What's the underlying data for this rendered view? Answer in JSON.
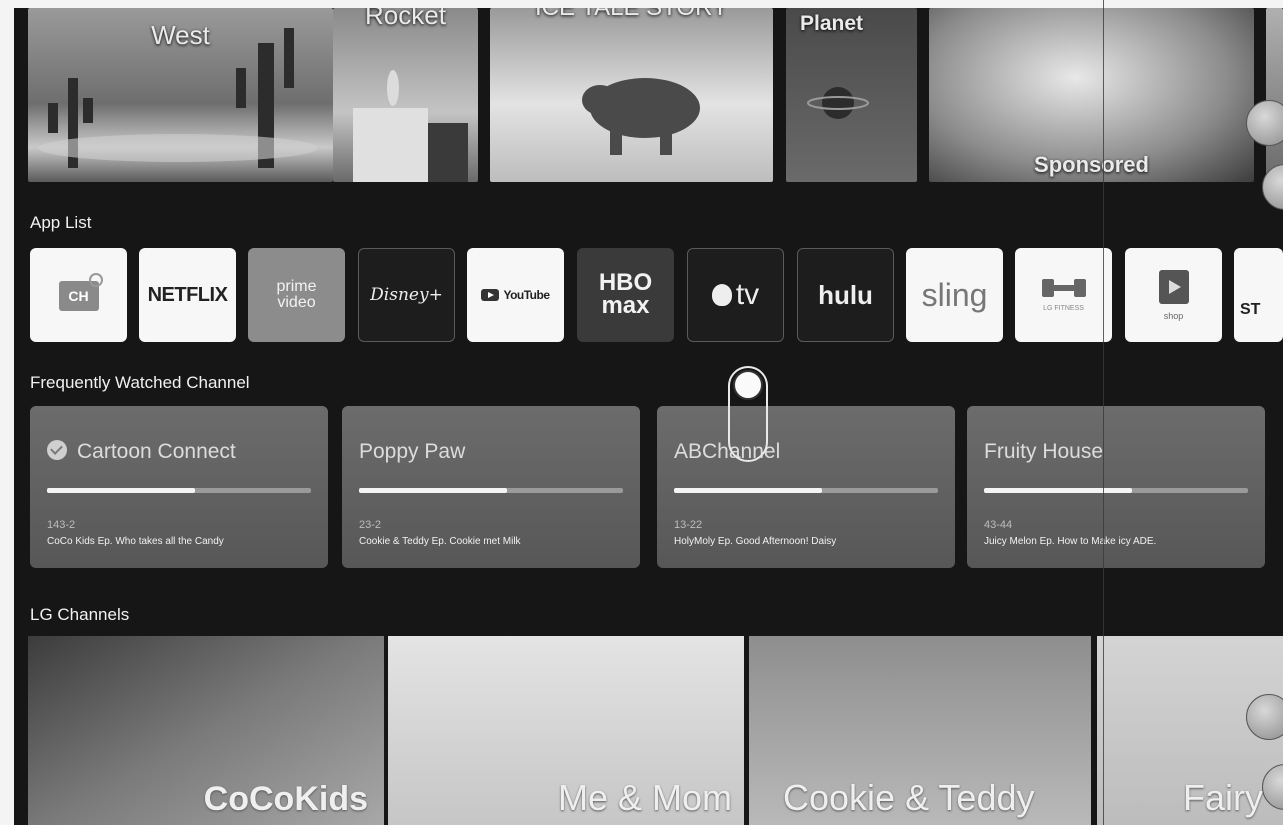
{
  "featured": [
    {
      "title": "West"
    },
    {
      "title": "Rocket"
    },
    {
      "title": "ICE TALE STORY"
    },
    {
      "title": "Planet"
    },
    {
      "title": "Sponsored"
    },
    {
      "title": ""
    }
  ],
  "app_list": {
    "label": "App List",
    "apps": [
      {
        "label": "CH",
        "icon": "live-tv-icon"
      },
      {
        "label": "NETFLIX"
      },
      {
        "label": "prime video"
      },
      {
        "label": "Disney+"
      },
      {
        "label": "YouTube"
      },
      {
        "label": "HBO max"
      },
      {
        "label": "tv"
      },
      {
        "label": "hulu"
      },
      {
        "label": "sling"
      },
      {
        "label": "LG FITNESS"
      },
      {
        "label": "shop"
      },
      {
        "label": "ST"
      }
    ]
  },
  "frequent": {
    "label": "Frequently Watched Channel",
    "channels": [
      {
        "name": "Cartoon Connect",
        "number": "143-2",
        "program": "CoCo Kids Ep. Who takes all the Candy",
        "progress": 0.56
      },
      {
        "name": "Poppy Paw",
        "number": "23-2",
        "program": "Cookie & Teddy Ep. Cookie met Milk",
        "progress": 0.56
      },
      {
        "name": "ABChannel",
        "number": "13-22",
        "program": "HolyMoly Ep. Good Afternoon! Daisy",
        "progress": 0.56
      },
      {
        "name": "Fruity House",
        "number": "43-44",
        "program": "Juicy Melon Ep. How to Make icy ADE.",
        "progress": 0.56
      }
    ]
  },
  "lg_channels": {
    "label": "LG Channels",
    "items": [
      {
        "title": "CoCoKids"
      },
      {
        "title": "Me & Mom"
      },
      {
        "title": "Cookie & Teddy"
      },
      {
        "title": "Fairy"
      }
    ]
  },
  "colors": {
    "background": "#161616",
    "progress_fill": "#f4f4f4"
  }
}
